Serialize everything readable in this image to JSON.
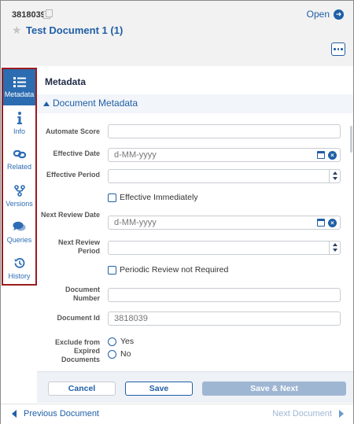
{
  "header": {
    "doc_id": "3818039",
    "open_label": "Open",
    "title": "Test Document 1 (1)"
  },
  "sidebar": {
    "items": [
      {
        "label": "Metadata",
        "icon": "list-icon",
        "active": true
      },
      {
        "label": "Info",
        "icon": "info-icon"
      },
      {
        "label": "Related",
        "icon": "link-icon"
      },
      {
        "label": "Versions",
        "icon": "branch-icon"
      },
      {
        "label": "Queries",
        "icon": "chat-icon"
      },
      {
        "label": "History",
        "icon": "history-icon"
      }
    ]
  },
  "main": {
    "title": "Metadata",
    "section_title": "Document Metadata",
    "fields": {
      "automate_score": {
        "label": "Automate Score",
        "value": ""
      },
      "effective_date": {
        "label": "Effective Date",
        "placeholder": "d-MM-yyyy"
      },
      "effective_period": {
        "label": "Effective Period",
        "value": ""
      },
      "effective_immediately": {
        "label": "Effective Immediately",
        "checked": false
      },
      "next_review_date": {
        "label": "Next Review Date",
        "placeholder": "d-MM-yyyy"
      },
      "next_review_period": {
        "label": "Next Review Period",
        "value": ""
      },
      "periodic_review": {
        "label": "Periodic Review not Required",
        "checked": false
      },
      "document_number": {
        "label": "Document Number",
        "value": ""
      },
      "document_id": {
        "label": "Document Id",
        "value": "3818039"
      },
      "exclude_expired": {
        "label": "Exclude from Expired Documents",
        "options": [
          "Yes",
          "No"
        ]
      }
    }
  },
  "buttons": {
    "cancel": "Cancel",
    "save": "Save",
    "save_next": "Save & Next"
  },
  "navigation": {
    "previous": "Previous Document",
    "next": "Next Document"
  },
  "colors": {
    "accent": "#1f5fa6",
    "sidebar_active": "#2c6cb0",
    "sidebar_border": "#9b1c1c",
    "disabled_button": "#9fb6d3"
  }
}
